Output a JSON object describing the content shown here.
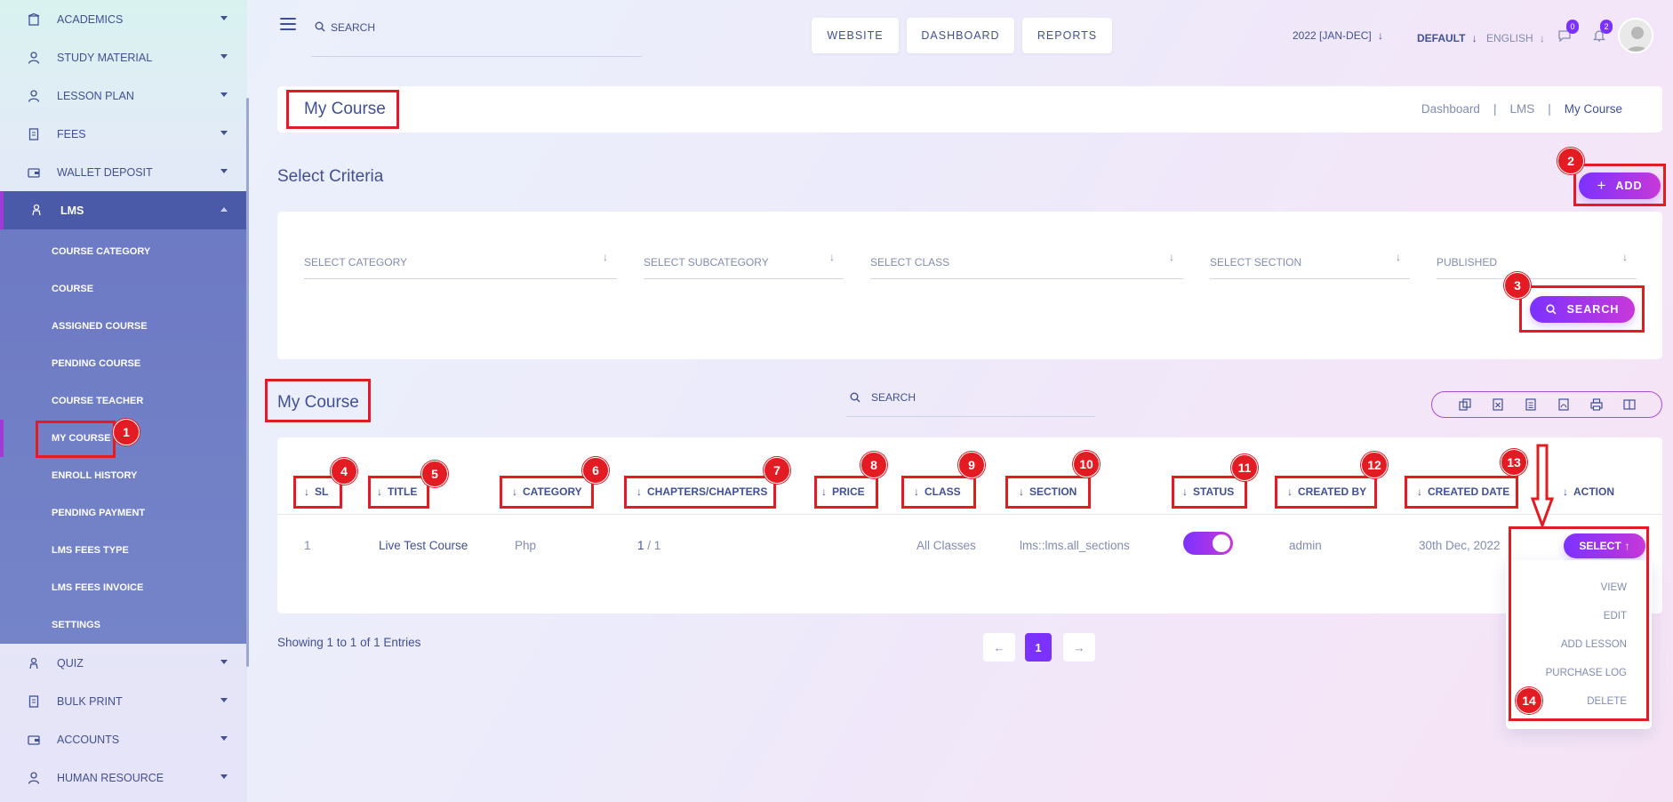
{
  "sidebar": {
    "items_top": [
      {
        "label": "ACADEMICS",
        "icon": "building-icon"
      },
      {
        "label": "STUDY MATERIAL",
        "icon": "person-icon"
      },
      {
        "label": "LESSON PLAN",
        "icon": "person-icon"
      },
      {
        "label": "FEES",
        "icon": "receipt-icon"
      },
      {
        "label": "WALLET DEPOSIT",
        "icon": "wallet-icon"
      }
    ],
    "lms": {
      "label": "LMS",
      "icon": "lms-icon"
    },
    "lms_items": [
      "COURSE CATEGORY",
      "COURSE",
      "ASSIGNED COURSE",
      "PENDING COURSE",
      "COURSE TEACHER",
      "MY COURSE",
      "ENROLL HISTORY",
      "PENDING PAYMENT",
      "LMS FEES TYPE",
      "LMS FEES INVOICE",
      "SETTINGS"
    ],
    "items_bottom": [
      {
        "label": "QUIZ",
        "icon": "quiz-icon"
      },
      {
        "label": "BULK PRINT",
        "icon": "print-doc-icon"
      },
      {
        "label": "ACCOUNTS",
        "icon": "accounts-icon"
      },
      {
        "label": "HUMAN RESOURCE",
        "icon": "person-icon"
      }
    ]
  },
  "topbar": {
    "search_placeholder": "SEARCH",
    "buttons": [
      "WEBSITE",
      "DASHBOARD",
      "REPORTS"
    ],
    "session": "2022 [JAN-DEC]",
    "style": "DEFAULT",
    "language": "ENGLISH",
    "messages_count": "0",
    "notifications_count": "2"
  },
  "page": {
    "title": "My Course",
    "breadcrumb": [
      "Dashboard",
      "LMS",
      "My Course"
    ]
  },
  "criteria": {
    "title": "Select Criteria",
    "add_label": "ADD",
    "fields": [
      "SELECT CATEGORY",
      "SELECT SUBCATEGORY",
      "SELECT CLASS",
      "SELECT SECTION",
      "PUBLISHED"
    ],
    "search_label": "SEARCH"
  },
  "list": {
    "title": "My Course",
    "search_placeholder": "SEARCH",
    "columns": [
      "SL",
      "TITLE",
      "CATEGORY",
      "CHAPTERS/CHAPTERS",
      "PRICE",
      "CLASS",
      "SECTION",
      "STATUS",
      "CREATED BY",
      "CREATED DATE",
      "ACTION"
    ],
    "rows": [
      {
        "sl": "1",
        "title": "Live Test Course",
        "category": "Php",
        "chapters_done": "1",
        "chapters_total": "/ 1",
        "price": "",
        "class": "All Classes",
        "section": "lms::lms.all_sections",
        "status_on": true,
        "created_by": "admin",
        "created_date": "30th Dec, 2022",
        "action_label": "SELECT"
      }
    ],
    "action_menu": [
      "VIEW",
      "EDIT",
      "ADD LESSON",
      "PURCHASE LOG",
      "DELETE"
    ],
    "showing": "Showing 1 to 1 of 1 Entries",
    "current_page": "1"
  },
  "annotations": [
    "1",
    "2",
    "3",
    "4",
    "5",
    "6",
    "7",
    "8",
    "9",
    "10",
    "11",
    "12",
    "13",
    "14"
  ],
  "colors": {
    "accent": "#7c32ff",
    "accent_end": "#c738d8",
    "annotation": "#e31b23",
    "text": "#415094",
    "sidebar_active": "#4a5aa8"
  }
}
